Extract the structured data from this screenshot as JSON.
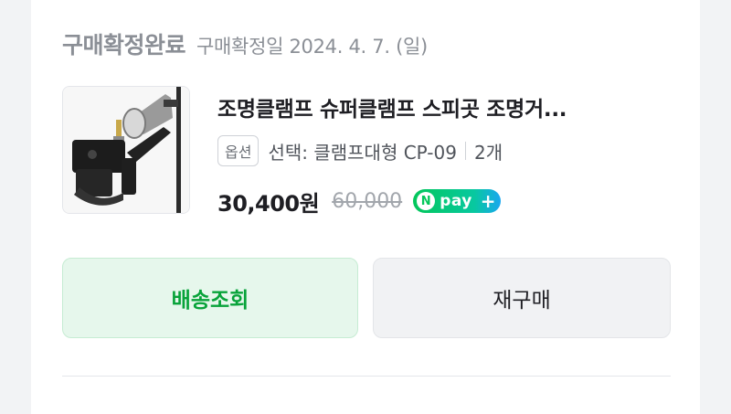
{
  "order": {
    "status_title": "구매확정완료",
    "status_date": "구매확정일 2024. 4. 7. (일)"
  },
  "product": {
    "name": "조명클램프 슈퍼클램프 스피곳 조명거...",
    "option_badge": "옵션",
    "option_text": "선택: 클램프대형 CP-09",
    "quantity": "2개",
    "price": "30,400원",
    "original_price": "60,000",
    "image_icon": "super-clamp-photo"
  },
  "npay": {
    "n": "N",
    "pay": "pay",
    "plus": "+",
    "colors": {
      "start": "#03c75a",
      "end": "#1aa7f0"
    }
  },
  "actions": {
    "track_label": "배송조회",
    "reorder_label": "재구매"
  },
  "colors": {
    "accent_green": "#08a33a",
    "track_bg": "#e6f7ec",
    "muted_text": "#8b8f96"
  }
}
